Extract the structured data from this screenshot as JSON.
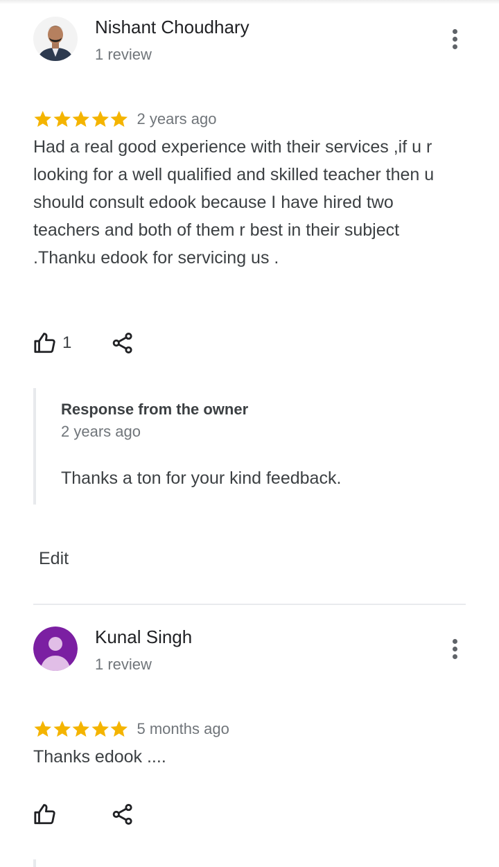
{
  "reviews": [
    {
      "reviewer_name": "Nishant Choudhary",
      "review_count": "1 review",
      "stars": 5,
      "time": "2 years ago",
      "text": "Had a real good experience with their services ,if u r looking for a well qualified and skilled teacher then u should consult edook because I have hired two teachers and both of them r best in their subject .Thanku edook for servicing us .",
      "likes": "1",
      "owner_response": {
        "title": "Response from the owner",
        "time": "2 years ago",
        "text": "Thanks a ton for your kind feedback."
      },
      "edit_label": "Edit"
    },
    {
      "reviewer_name": "Kunal Singh",
      "review_count": "1 review",
      "stars": 5,
      "time": "5 months ago",
      "text": "Thanks edook ....",
      "likes": ""
    }
  ],
  "colors": {
    "star": "#f4b400",
    "avatar_purple": "#7b1fa2",
    "divider": "#e8eaed"
  },
  "icons": {
    "more": "more-vert-icon",
    "like": "thumb-up-icon",
    "share": "share-icon",
    "star": "star-icon"
  }
}
